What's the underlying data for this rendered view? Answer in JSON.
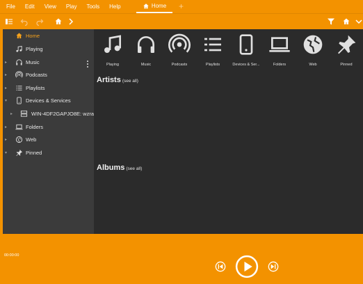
{
  "menu": {
    "items": [
      "File",
      "Edit",
      "View",
      "Play",
      "Tools",
      "Help"
    ],
    "active_tab": "Home",
    "add_tab": "+"
  },
  "sidebar": {
    "items": [
      {
        "label": "Home",
        "icon": "home-icon",
        "active": true
      },
      {
        "label": "Playing",
        "icon": "music-note-icon"
      },
      {
        "label": "Music",
        "icon": "headphones-icon"
      },
      {
        "label": "Podcasts",
        "icon": "podcast-icon"
      },
      {
        "label": "Playlists",
        "icon": "playlist-icon"
      },
      {
        "label": "Devices & Services",
        "icon": "phone-icon"
      },
      {
        "label": "WIN-4DF2GAPJO8E: wzral",
        "icon": "server-icon"
      },
      {
        "label": "Folders",
        "icon": "laptop-icon"
      },
      {
        "label": "Web",
        "icon": "globe-icon"
      },
      {
        "label": "Pinned",
        "icon": "pin-icon"
      }
    ]
  },
  "tiles": [
    {
      "label": "Playing",
      "icon": "music-note-icon"
    },
    {
      "label": "Music",
      "icon": "headphones-icon"
    },
    {
      "label": "Podcasts",
      "icon": "podcast-icon"
    },
    {
      "label": "Playlists",
      "icon": "playlist-icon"
    },
    {
      "label": "Devices & Ser...",
      "icon": "phone-icon"
    },
    {
      "label": "Folders",
      "icon": "laptop-icon"
    },
    {
      "label": "Web",
      "icon": "globe-icon"
    },
    {
      "label": "Pinned",
      "icon": "pin-icon"
    }
  ],
  "sections": {
    "artists": {
      "title": "Artists",
      "see_all": "(see all)"
    },
    "albums": {
      "title": "Albums",
      "see_all": "(see all)"
    }
  },
  "player": {
    "time": "00:00:00"
  },
  "colors": {
    "accent": "#f39200",
    "sidebar": "#3b3b3b",
    "main": "#2b2b2b",
    "active_text": "#f7a21b"
  }
}
